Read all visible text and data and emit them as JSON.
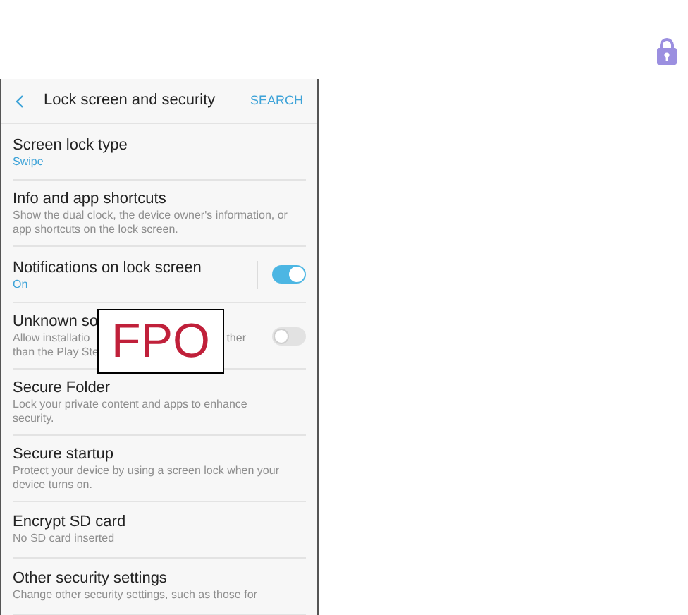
{
  "header": {
    "title": "Lock screen and security",
    "action": "SEARCH"
  },
  "items": [
    {
      "kind": "link",
      "title": "Screen lock type",
      "value": "Swipe"
    },
    {
      "kind": "link",
      "title": "Info and app shortcuts",
      "description_lines": [
        [
          "Show the dual clock, the device owner's information, or"
        ],
        [
          "app shortcuts on the lock screen."
        ]
      ]
    },
    {
      "kind": "toggle",
      "title": "Notifications on lock screen",
      "value": "On",
      "on": true,
      "divider": true
    },
    {
      "kind": "toggle",
      "title": "Unknown so",
      "on": false,
      "divider": false,
      "overlay": "FPO",
      "description_lines": [
        [
          "Allow installatio",
          "ther"
        ],
        [
          "than the Play Ste"
        ]
      ]
    },
    {
      "kind": "link",
      "title": "Secure Folder",
      "description_lines": [
        [
          "Lock your private content and apps to enhance"
        ],
        [
          "security."
        ]
      ]
    },
    {
      "kind": "link",
      "title": "Secure startup",
      "description_lines": [
        [
          "Protect your device by using a screen lock when your"
        ],
        [
          "device turns on."
        ]
      ]
    },
    {
      "kind": "link",
      "title": "Encrypt SD card",
      "description_lines": [
        [
          "No SD card inserted"
        ]
      ]
    },
    {
      "kind": "link",
      "title": "Other security settings",
      "description_lines": [
        [
          "Change other security settings, such as those for"
        ]
      ]
    }
  ]
}
